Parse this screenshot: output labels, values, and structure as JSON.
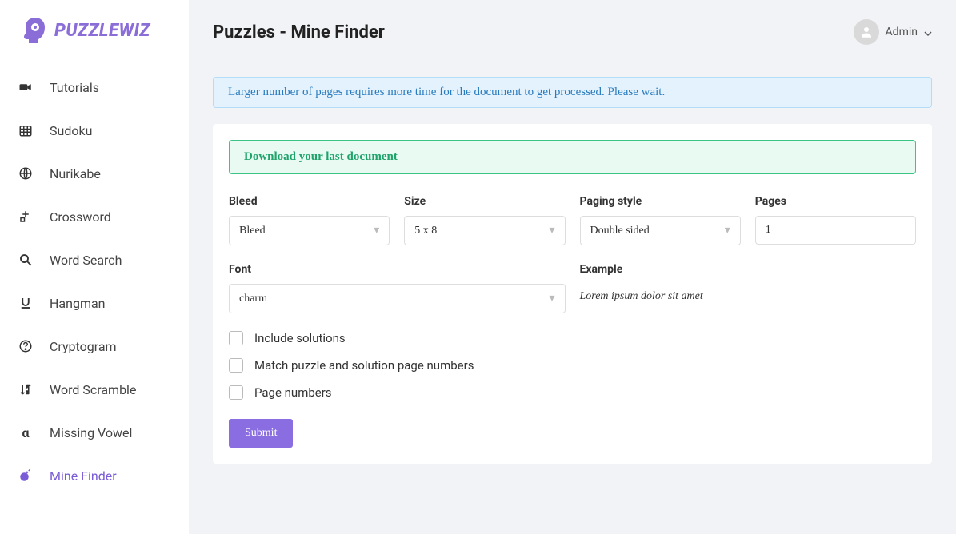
{
  "brand": {
    "name": "PuzzleWiz"
  },
  "sidebar": {
    "items": [
      {
        "label": "Tutorials",
        "icon": "video-icon"
      },
      {
        "label": "Sudoku",
        "icon": "calendar-icon"
      },
      {
        "label": "Nurikabe",
        "icon": "globe-icon"
      },
      {
        "label": "Crossword",
        "icon": "puzzle-icon"
      },
      {
        "label": "Word Search",
        "icon": "search-icon"
      },
      {
        "label": "Hangman",
        "icon": "underline-icon"
      },
      {
        "label": "Cryptogram",
        "icon": "question-icon"
      },
      {
        "label": "Word Scramble",
        "icon": "sort-icon"
      },
      {
        "label": "Missing Vowel",
        "icon": "alpha-icon"
      },
      {
        "label": "Mine Finder",
        "icon": "bomb-icon",
        "active": true
      }
    ]
  },
  "header": {
    "title": "Puzzles - Mine Finder",
    "user": "Admin"
  },
  "alert": "Larger number of pages requires more time for the document to get processed. Please wait.",
  "download_link": "Download your last document",
  "form": {
    "bleed": {
      "label": "Bleed",
      "value": "Bleed"
    },
    "size": {
      "label": "Size",
      "value": "5 x 8"
    },
    "paging": {
      "label": "Paging style",
      "value": "Double sided"
    },
    "pages": {
      "label": "Pages",
      "value": "1"
    },
    "font": {
      "label": "Font",
      "value": "charm"
    },
    "example": {
      "label": "Example",
      "value": "Lorem ipsum dolor sit amet"
    },
    "checks": [
      "Include solutions",
      "Match puzzle and solution page numbers",
      "Page numbers"
    ],
    "submit": "Submit"
  }
}
